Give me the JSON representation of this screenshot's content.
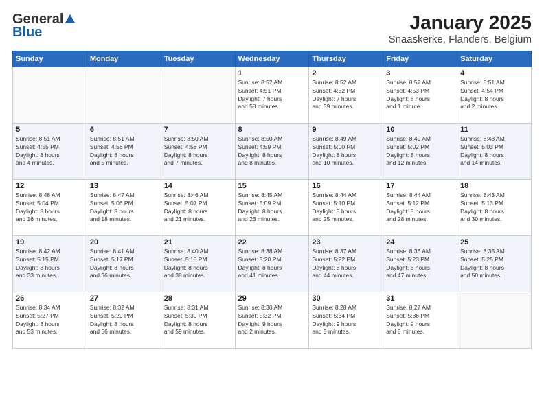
{
  "logo": {
    "general": "General",
    "blue": "Blue"
  },
  "title": "January 2025",
  "subtitle": "Snaaskerke, Flanders, Belgium",
  "days_of_week": [
    "Sunday",
    "Monday",
    "Tuesday",
    "Wednesday",
    "Thursday",
    "Friday",
    "Saturday"
  ],
  "weeks": [
    [
      {
        "num": "",
        "info": ""
      },
      {
        "num": "",
        "info": ""
      },
      {
        "num": "",
        "info": ""
      },
      {
        "num": "1",
        "info": "Sunrise: 8:52 AM\nSunset: 4:51 PM\nDaylight: 7 hours\nand 58 minutes."
      },
      {
        "num": "2",
        "info": "Sunrise: 8:52 AM\nSunset: 4:52 PM\nDaylight: 7 hours\nand 59 minutes."
      },
      {
        "num": "3",
        "info": "Sunrise: 8:52 AM\nSunset: 4:53 PM\nDaylight: 8 hours\nand 1 minute."
      },
      {
        "num": "4",
        "info": "Sunrise: 8:51 AM\nSunset: 4:54 PM\nDaylight: 8 hours\nand 2 minutes."
      }
    ],
    [
      {
        "num": "5",
        "info": "Sunrise: 8:51 AM\nSunset: 4:55 PM\nDaylight: 8 hours\nand 4 minutes."
      },
      {
        "num": "6",
        "info": "Sunrise: 8:51 AM\nSunset: 4:56 PM\nDaylight: 8 hours\nand 5 minutes."
      },
      {
        "num": "7",
        "info": "Sunrise: 8:50 AM\nSunset: 4:58 PM\nDaylight: 8 hours\nand 7 minutes."
      },
      {
        "num": "8",
        "info": "Sunrise: 8:50 AM\nSunset: 4:59 PM\nDaylight: 8 hours\nand 8 minutes."
      },
      {
        "num": "9",
        "info": "Sunrise: 8:49 AM\nSunset: 5:00 PM\nDaylight: 8 hours\nand 10 minutes."
      },
      {
        "num": "10",
        "info": "Sunrise: 8:49 AM\nSunset: 5:02 PM\nDaylight: 8 hours\nand 12 minutes."
      },
      {
        "num": "11",
        "info": "Sunrise: 8:48 AM\nSunset: 5:03 PM\nDaylight: 8 hours\nand 14 minutes."
      }
    ],
    [
      {
        "num": "12",
        "info": "Sunrise: 8:48 AM\nSunset: 5:04 PM\nDaylight: 8 hours\nand 16 minutes."
      },
      {
        "num": "13",
        "info": "Sunrise: 8:47 AM\nSunset: 5:06 PM\nDaylight: 8 hours\nand 18 minutes."
      },
      {
        "num": "14",
        "info": "Sunrise: 8:46 AM\nSunset: 5:07 PM\nDaylight: 8 hours\nand 21 minutes."
      },
      {
        "num": "15",
        "info": "Sunrise: 8:45 AM\nSunset: 5:09 PM\nDaylight: 8 hours\nand 23 minutes."
      },
      {
        "num": "16",
        "info": "Sunrise: 8:44 AM\nSunset: 5:10 PM\nDaylight: 8 hours\nand 25 minutes."
      },
      {
        "num": "17",
        "info": "Sunrise: 8:44 AM\nSunset: 5:12 PM\nDaylight: 8 hours\nand 28 minutes."
      },
      {
        "num": "18",
        "info": "Sunrise: 8:43 AM\nSunset: 5:13 PM\nDaylight: 8 hours\nand 30 minutes."
      }
    ],
    [
      {
        "num": "19",
        "info": "Sunrise: 8:42 AM\nSunset: 5:15 PM\nDaylight: 8 hours\nand 33 minutes."
      },
      {
        "num": "20",
        "info": "Sunrise: 8:41 AM\nSunset: 5:17 PM\nDaylight: 8 hours\nand 36 minutes."
      },
      {
        "num": "21",
        "info": "Sunrise: 8:40 AM\nSunset: 5:18 PM\nDaylight: 8 hours\nand 38 minutes."
      },
      {
        "num": "22",
        "info": "Sunrise: 8:38 AM\nSunset: 5:20 PM\nDaylight: 8 hours\nand 41 minutes."
      },
      {
        "num": "23",
        "info": "Sunrise: 8:37 AM\nSunset: 5:22 PM\nDaylight: 8 hours\nand 44 minutes."
      },
      {
        "num": "24",
        "info": "Sunrise: 8:36 AM\nSunset: 5:23 PM\nDaylight: 8 hours\nand 47 minutes."
      },
      {
        "num": "25",
        "info": "Sunrise: 8:35 AM\nSunset: 5:25 PM\nDaylight: 8 hours\nand 50 minutes."
      }
    ],
    [
      {
        "num": "26",
        "info": "Sunrise: 8:34 AM\nSunset: 5:27 PM\nDaylight: 8 hours\nand 53 minutes."
      },
      {
        "num": "27",
        "info": "Sunrise: 8:32 AM\nSunset: 5:29 PM\nDaylight: 8 hours\nand 56 minutes."
      },
      {
        "num": "28",
        "info": "Sunrise: 8:31 AM\nSunset: 5:30 PM\nDaylight: 8 hours\nand 59 minutes."
      },
      {
        "num": "29",
        "info": "Sunrise: 8:30 AM\nSunset: 5:32 PM\nDaylight: 9 hours\nand 2 minutes."
      },
      {
        "num": "30",
        "info": "Sunrise: 8:28 AM\nSunset: 5:34 PM\nDaylight: 9 hours\nand 5 minutes."
      },
      {
        "num": "31",
        "info": "Sunrise: 8:27 AM\nSunset: 5:36 PM\nDaylight: 9 hours\nand 8 minutes."
      },
      {
        "num": "",
        "info": ""
      }
    ]
  ]
}
